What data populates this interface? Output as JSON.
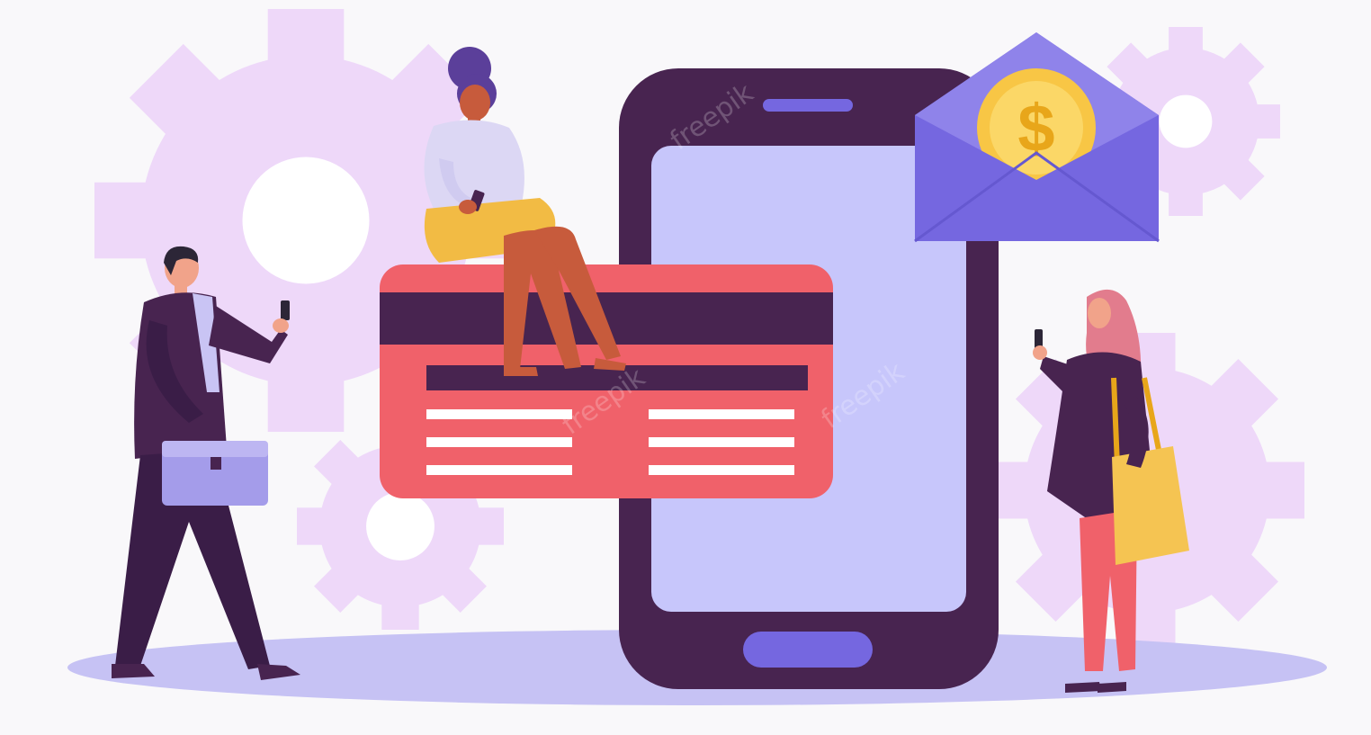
{
  "illustration": {
    "coin_symbol": "$",
    "watermark": "freepik",
    "colors": {
      "background": "#f9f8fa",
      "gear": "#eed8f9",
      "floor": "#c6c2f4",
      "phone_body": "#482450",
      "phone_screen": "#c7c6fb",
      "phone_accent": "#7567e0",
      "card": "#f0616a",
      "card_stripe": "#482450",
      "envelope": "#7567e0",
      "envelope_inner": "#8f83ea",
      "coin": "#f8c645",
      "coin_inner": "#fbd767",
      "coin_text": "#e8a61a"
    },
    "figures": [
      "businessman-walking",
      "woman-sitting-on-card",
      "woman-with-bag"
    ]
  }
}
